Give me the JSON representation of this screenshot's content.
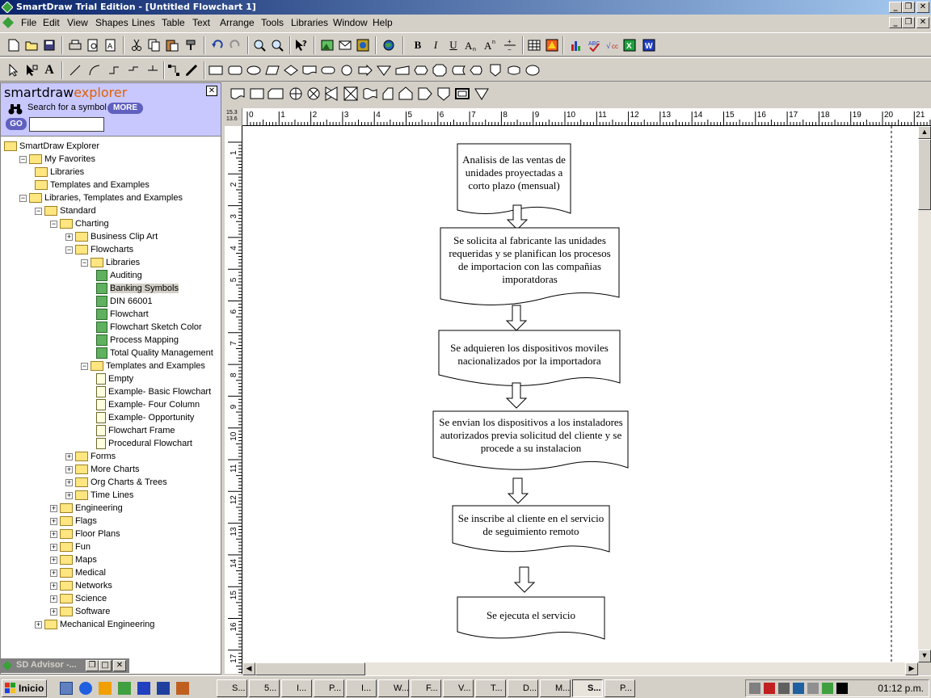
{
  "window": {
    "title": "SmartDraw Trial Edition - [Untitled Flowchart 1]"
  },
  "menu": [
    "File",
    "Edit",
    "View",
    "Shapes",
    "Lines",
    "Table",
    "Text",
    "Arrange",
    "Tools",
    "Libraries",
    "Window",
    "Help"
  ],
  "toolbar": {
    "bold": "B",
    "italic": "I",
    "underline": "U"
  },
  "explorer": {
    "logo_a": "smartdraw",
    "logo_b": "explorer",
    "search_label": "Search for a symbol",
    "more_label": "MORE",
    "go_label": "GO",
    "search_value": "",
    "close": "✕"
  },
  "tree": [
    {
      "label": "SmartDraw Explorer",
      "kind": "folder",
      "exp": "",
      "selected": false
    },
    {
      "label": "My Favorites",
      "kind": "folder",
      "exp": "−",
      "selected": false
    },
    {
      "label": "Libraries",
      "kind": "folder",
      "exp": "",
      "selected": false
    },
    {
      "label": "Templates and Examples",
      "kind": "folder",
      "exp": "",
      "selected": false
    },
    {
      "label": "Libraries, Templates and Examples",
      "kind": "folder",
      "exp": "−",
      "selected": false
    },
    {
      "label": "Standard",
      "kind": "folder",
      "exp": "−",
      "selected": false
    },
    {
      "label": "Charting",
      "kind": "folder",
      "exp": "−",
      "selected": false
    },
    {
      "label": "Business Clip Art",
      "kind": "folder",
      "exp": "+",
      "selected": false
    },
    {
      "label": "Flowcharts",
      "kind": "folder",
      "exp": "−",
      "selected": false
    },
    {
      "label": "Libraries",
      "kind": "folder",
      "exp": "−",
      "selected": false
    },
    {
      "label": "Auditing",
      "kind": "lib",
      "exp": "",
      "selected": false
    },
    {
      "label": "Banking Symbols",
      "kind": "lib",
      "exp": "",
      "selected": true
    },
    {
      "label": "DIN 66001",
      "kind": "lib",
      "exp": "",
      "selected": false
    },
    {
      "label": "Flowchart",
      "kind": "lib",
      "exp": "",
      "selected": false
    },
    {
      "label": "Flowchart Sketch Color",
      "kind": "lib",
      "exp": "",
      "selected": false
    },
    {
      "label": "Process Mapping",
      "kind": "lib",
      "exp": "",
      "selected": false
    },
    {
      "label": "Total Quality Management",
      "kind": "lib",
      "exp": "",
      "selected": false
    },
    {
      "label": "Templates and Examples",
      "kind": "folder",
      "exp": "−",
      "selected": false
    },
    {
      "label": "Empty",
      "kind": "tmpl",
      "exp": "",
      "selected": false
    },
    {
      "label": "Example- Basic Flowchart",
      "kind": "tmpl",
      "exp": "",
      "selected": false
    },
    {
      "label": "Example- Four Column",
      "kind": "tmpl",
      "exp": "",
      "selected": false
    },
    {
      "label": "Example- Opportunity",
      "kind": "tmpl",
      "exp": "",
      "selected": false
    },
    {
      "label": "Flowchart Frame",
      "kind": "tmpl",
      "exp": "",
      "selected": false
    },
    {
      "label": "Procedural Flowchart",
      "kind": "tmpl",
      "exp": "",
      "selected": false
    },
    {
      "label": "Forms",
      "kind": "folder",
      "exp": "+",
      "selected": false
    },
    {
      "label": "More Charts",
      "kind": "folder",
      "exp": "+",
      "selected": false
    },
    {
      "label": "Org Charts & Trees",
      "kind": "folder",
      "exp": "+",
      "selected": false
    },
    {
      "label": "Time Lines",
      "kind": "folder",
      "exp": "+",
      "selected": false
    },
    {
      "label": "Engineering",
      "kind": "folder",
      "exp": "+",
      "selected": false
    },
    {
      "label": "Flags",
      "kind": "folder",
      "exp": "+",
      "selected": false
    },
    {
      "label": "Floor Plans",
      "kind": "folder",
      "exp": "+",
      "selected": false
    },
    {
      "label": "Fun",
      "kind": "folder",
      "exp": "+",
      "selected": false
    },
    {
      "label": "Maps",
      "kind": "folder",
      "exp": "+",
      "selected": false
    },
    {
      "label": "Medical",
      "kind": "folder",
      "exp": "+",
      "selected": false
    },
    {
      "label": "Networks",
      "kind": "folder",
      "exp": "+",
      "selected": false
    },
    {
      "label": "Science",
      "kind": "folder",
      "exp": "+",
      "selected": false
    },
    {
      "label": "Software",
      "kind": "folder",
      "exp": "+",
      "selected": false
    },
    {
      "label": "Mechanical Engineering",
      "kind": "folder",
      "exp": "+",
      "selected": false
    }
  ],
  "advisor": {
    "label": "SD Advisor -..."
  },
  "ruler": {
    "h_ticks": [
      "0",
      "1",
      "2",
      "3",
      "4",
      "5",
      "6",
      "7",
      "8",
      "9",
      "10",
      "11",
      "12",
      "13",
      "14",
      "15",
      "16",
      "17",
      "18",
      "19",
      "20",
      "21"
    ],
    "v_ticks": [
      "1",
      "2",
      "3",
      "4",
      "5",
      "6",
      "7",
      "8",
      "9",
      "10",
      "11",
      "12",
      "13",
      "14",
      "15",
      "16",
      "17"
    ],
    "corner": "15.3 13.6"
  },
  "flowchart": [
    "Analisis de las ventas de unidades proyectadas a corto plazo (mensual)",
    "Se solicita al fabricante las unidades requeridas y se planifican los procesos de importacion con las compañias imporatdoras",
    "Se adquieren los dispositivos moviles nacionalizados por la importadora",
    "Se envian los dispositivos a los instaladores autorizados previa solicitud del cliente y se procede a su instalacion",
    "Se inscribe al cliente en el servicio de seguimiento remoto",
    "Se ejecuta el servicio"
  ],
  "taskbar": {
    "start": "Inicio",
    "tasks": [
      "S...",
      "5...",
      "I...",
      "P...",
      "I...",
      "W...",
      "F...",
      "V...",
      "T...",
      "D...",
      "M...",
      "S...",
      "P..."
    ],
    "clock": "01:12 p.m."
  }
}
